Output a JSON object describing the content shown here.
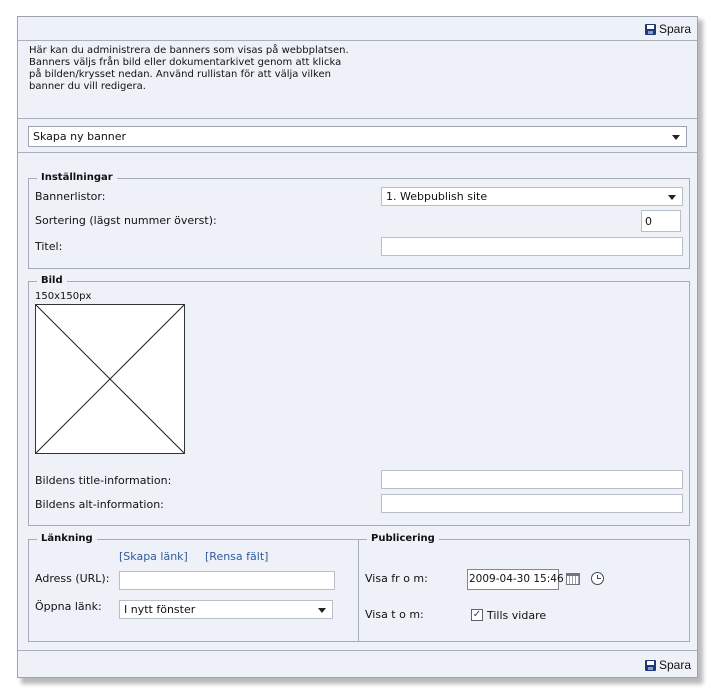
{
  "toolbar": {
    "save_label": "Spara"
  },
  "footer": {
    "save_label": "Spara"
  },
  "info": {
    "lines": [
      "Här kan du administrera de banners som visas på webbplatsen.",
      "Banners väljs från bild eller dokumentarkivet genom att klicka",
      "på bilden/krysset nedan. Använd rullistan för att välja vilken",
      "banner du vill redigera."
    ]
  },
  "banner_select": {
    "value": "Skapa ny banner"
  },
  "settings": {
    "legend": "Inställningar",
    "bannerlist_label": "Bannerlistor:",
    "bannerlist_value": "1. Webpublish site",
    "sort_label": "Sortering (lägst nummer överst):",
    "sort_value": "0",
    "title_label": "Titel:",
    "title_value": ""
  },
  "image": {
    "legend": "Bild",
    "size_text": "150x150px",
    "title_info_label": "Bildens title-information:",
    "title_info_value": "",
    "alt_info_label": "Bildens alt-information:",
    "alt_info_value": ""
  },
  "linking": {
    "legend": "Länkning",
    "create_link": "[Skapa länk]",
    "clear_fields": "[Rensa fält]",
    "address_label": "Adress (URL):",
    "address_value": "",
    "open_link_label": "Öppna länk:",
    "open_link_value": "I nytt fönster"
  },
  "publishing": {
    "legend": "Publicering",
    "show_from_label": "Visa fr o m:",
    "show_from_value": "2009-04-30 15:46",
    "show_to_label": "Visa t o m:",
    "until_further_label": "Tills vidare",
    "until_further_checked": true
  },
  "icons": [
    "floppy-disk-icon",
    "calendar-icon",
    "clock-icon",
    "checkbox-checked-icon",
    "dropdown-arrow-icon"
  ]
}
